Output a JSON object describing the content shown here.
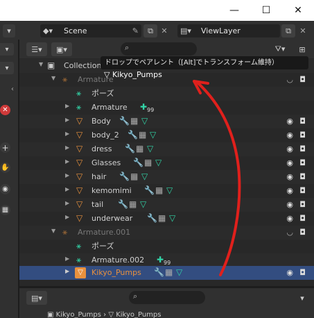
{
  "window": {
    "minimize": "—",
    "maximize": "☐",
    "close": "✕"
  },
  "topbar": {
    "scene_label": "Scene",
    "viewlayer_label": "ViewLayer"
  },
  "tooltip": "ドロップでペアレント（[Alt]でトランスフォーム維持）",
  "drag_label": "Kikyo_Pumps",
  "outliner": {
    "rows": [
      {
        "label": "Collection",
        "kind": "collection"
      },
      {
        "label": "Armature",
        "kind": "armature-dim"
      },
      {
        "label": "ポーズ",
        "kind": "pose"
      },
      {
        "label": "Armature",
        "kind": "armature-data",
        "badge": "99"
      },
      {
        "label": "Body",
        "kind": "mesh"
      },
      {
        "label": "body_2",
        "kind": "mesh"
      },
      {
        "label": "dress",
        "kind": "mesh"
      },
      {
        "label": "Glasses",
        "kind": "mesh"
      },
      {
        "label": "hair",
        "kind": "mesh"
      },
      {
        "label": "kemomimi",
        "kind": "mesh"
      },
      {
        "label": "tail",
        "kind": "mesh"
      },
      {
        "label": "underwear",
        "kind": "mesh"
      },
      {
        "label": "Armature.001",
        "kind": "armature-dim"
      },
      {
        "label": "ポーズ",
        "kind": "pose"
      },
      {
        "label": "Armature.002",
        "kind": "armature-data",
        "badge": "99"
      },
      {
        "label": "Kikyo_Pumps",
        "kind": "mesh-selected"
      }
    ]
  },
  "bottom": {
    "breadcrumb_left": "Kikyo_Pumps",
    "breadcrumb_right": "Kikyo_Pumps"
  },
  "colors": {
    "accent_orange": "#e8913e",
    "selection_blue": "#334d80",
    "arrow_red": "#e0201c",
    "icon_cyan": "#32d4a7",
    "icon_blue": "#7ab0e8"
  }
}
